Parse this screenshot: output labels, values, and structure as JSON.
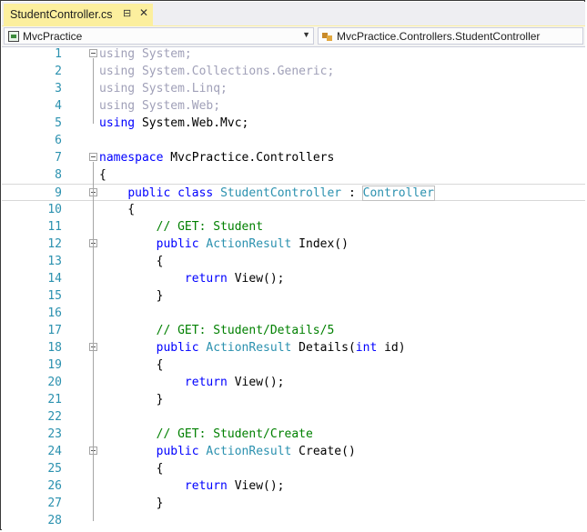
{
  "tab": {
    "title": "StudentController.cs",
    "pin_icon": "pin-icon",
    "close_icon": "close-icon"
  },
  "nav": {
    "project": "MvcPractice",
    "class_path": "MvcPractice.Controllers.StudentController"
  },
  "colors": {
    "tab_active": "#fcef9e",
    "line_number": "#2b91af",
    "keyword": "#0000ff",
    "type": "#2b91af",
    "comment": "#008000",
    "unused_using": "#a0a0b8"
  },
  "lines": [
    {
      "n": "1",
      "parts": [
        {
          "t": "using",
          "c": "faded"
        },
        {
          "t": " System;",
          "c": "faded"
        }
      ]
    },
    {
      "n": "2",
      "parts": [
        {
          "t": "using",
          "c": "faded"
        },
        {
          "t": " System.Collections.Generic;",
          "c": "faded"
        }
      ]
    },
    {
      "n": "3",
      "parts": [
        {
          "t": "using",
          "c": "faded"
        },
        {
          "t": " System.Linq;",
          "c": "faded"
        }
      ]
    },
    {
      "n": "4",
      "parts": [
        {
          "t": "using",
          "c": "faded"
        },
        {
          "t": " System.Web;",
          "c": "faded"
        }
      ]
    },
    {
      "n": "5",
      "parts": [
        {
          "t": "using",
          "c": "kw"
        },
        {
          "t": " System.Web.Mvc;",
          "c": "plain"
        }
      ]
    },
    {
      "n": "6",
      "parts": []
    },
    {
      "n": "7",
      "parts": [
        {
          "t": "namespace",
          "c": "kw"
        },
        {
          "t": " MvcPractice.Controllers",
          "c": "plain"
        }
      ]
    },
    {
      "n": "8",
      "parts": [
        {
          "t": "{",
          "c": "plain"
        }
      ]
    },
    {
      "n": "9",
      "parts": [
        {
          "t": "    ",
          "c": "plain"
        },
        {
          "t": "public",
          "c": "kw"
        },
        {
          "t": " ",
          "c": "plain"
        },
        {
          "t": "class",
          "c": "kw"
        },
        {
          "t": " ",
          "c": "plain"
        },
        {
          "t": "StudentController",
          "c": "type"
        },
        {
          "t": " : ",
          "c": "plain"
        },
        {
          "t": "Controller",
          "c": "type"
        }
      ]
    },
    {
      "n": "10",
      "parts": [
        {
          "t": "    {",
          "c": "plain"
        }
      ]
    },
    {
      "n": "11",
      "parts": [
        {
          "t": "        ",
          "c": "plain"
        },
        {
          "t": "// GET: Student",
          "c": "cm"
        }
      ]
    },
    {
      "n": "12",
      "parts": [
        {
          "t": "        ",
          "c": "plain"
        },
        {
          "t": "public",
          "c": "kw"
        },
        {
          "t": " ",
          "c": "plain"
        },
        {
          "t": "ActionResult",
          "c": "type"
        },
        {
          "t": " Index()",
          "c": "plain"
        }
      ]
    },
    {
      "n": "13",
      "parts": [
        {
          "t": "        {",
          "c": "plain"
        }
      ]
    },
    {
      "n": "14",
      "parts": [
        {
          "t": "            ",
          "c": "plain"
        },
        {
          "t": "return",
          "c": "kw"
        },
        {
          "t": " View();",
          "c": "plain"
        }
      ]
    },
    {
      "n": "15",
      "parts": [
        {
          "t": "        }",
          "c": "plain"
        }
      ]
    },
    {
      "n": "16",
      "parts": []
    },
    {
      "n": "17",
      "parts": [
        {
          "t": "        ",
          "c": "plain"
        },
        {
          "t": "// GET: Student/Details/5",
          "c": "cm"
        }
      ]
    },
    {
      "n": "18",
      "parts": [
        {
          "t": "        ",
          "c": "plain"
        },
        {
          "t": "public",
          "c": "kw"
        },
        {
          "t": " ",
          "c": "plain"
        },
        {
          "t": "ActionResult",
          "c": "type"
        },
        {
          "t": " Details(",
          "c": "plain"
        },
        {
          "t": "int",
          "c": "kw"
        },
        {
          "t": " id)",
          "c": "plain"
        }
      ]
    },
    {
      "n": "19",
      "parts": [
        {
          "t": "        {",
          "c": "plain"
        }
      ]
    },
    {
      "n": "20",
      "parts": [
        {
          "t": "            ",
          "c": "plain"
        },
        {
          "t": "return",
          "c": "kw"
        },
        {
          "t": " View();",
          "c": "plain"
        }
      ]
    },
    {
      "n": "21",
      "parts": [
        {
          "t": "        }",
          "c": "plain"
        }
      ]
    },
    {
      "n": "22",
      "parts": []
    },
    {
      "n": "23",
      "parts": [
        {
          "t": "        ",
          "c": "plain"
        },
        {
          "t": "// GET: Student/Create",
          "c": "cm"
        }
      ]
    },
    {
      "n": "24",
      "parts": [
        {
          "t": "        ",
          "c": "plain"
        },
        {
          "t": "public",
          "c": "kw"
        },
        {
          "t": " ",
          "c": "plain"
        },
        {
          "t": "ActionResult",
          "c": "type"
        },
        {
          "t": " Create()",
          "c": "plain"
        }
      ]
    },
    {
      "n": "25",
      "parts": [
        {
          "t": "        {",
          "c": "plain"
        }
      ]
    },
    {
      "n": "26",
      "parts": [
        {
          "t": "            ",
          "c": "plain"
        },
        {
          "t": "return",
          "c": "kw"
        },
        {
          "t": " View();",
          "c": "plain"
        }
      ]
    },
    {
      "n": "27",
      "parts": [
        {
          "t": "        }",
          "c": "plain"
        }
      ]
    },
    {
      "n": "28",
      "parts": []
    }
  ],
  "current_line": "9",
  "fold_lines": [
    "1",
    "7",
    "9",
    "12",
    "18",
    "24"
  ]
}
